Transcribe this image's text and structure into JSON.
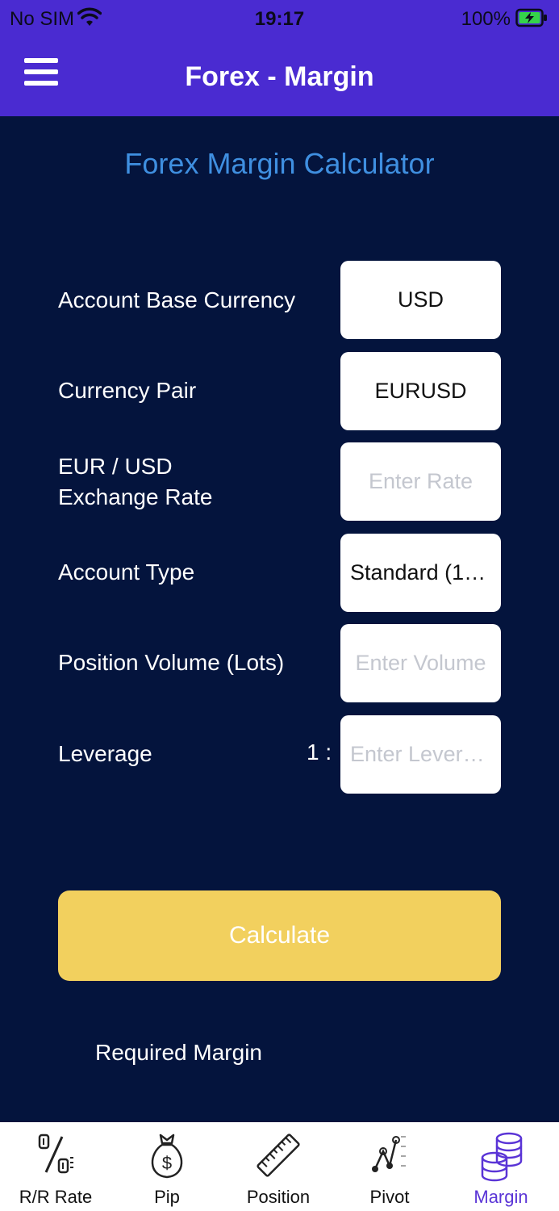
{
  "status": {
    "carrier": "No SIM",
    "time": "19:17",
    "battery": "100%"
  },
  "nav": {
    "title": "Forex - Margin"
  },
  "form": {
    "heading": "Forex Margin Calculator",
    "base_currency_label": "Account Base Currency",
    "base_currency_value": "USD",
    "pair_label": "Currency Pair",
    "pair_value": "EURUSD",
    "rate_label_line1": "EUR / USD",
    "rate_label_line2": "Exchange Rate",
    "rate_placeholder": "Enter Rate",
    "account_type_label": "Account Type",
    "account_type_value": "Standard (1 L...",
    "volume_label": "Position Volume (Lots)",
    "volume_placeholder": "Enter Volume",
    "leverage_label": "Leverage",
    "leverage_prefix": "1 :",
    "leverage_placeholder": "Enter Levera...",
    "calculate_label": "Calculate",
    "result_label": "Required Margin"
  },
  "colors": {
    "accent": "#4a2bd1",
    "background": "#04143d",
    "heading": "#3f8fe0",
    "button": "#f2d05e",
    "tab_active": "#5a34d6"
  },
  "tabs": [
    {
      "label": "R/R Rate",
      "icon": "percent-icon"
    },
    {
      "label": "Pip",
      "icon": "money-bag-icon"
    },
    {
      "label": "Position",
      "icon": "ruler-icon"
    },
    {
      "label": "Pivot",
      "icon": "pivot-chart-icon"
    },
    {
      "label": "Margin",
      "icon": "coins-stack-icon",
      "active": true
    }
  ]
}
